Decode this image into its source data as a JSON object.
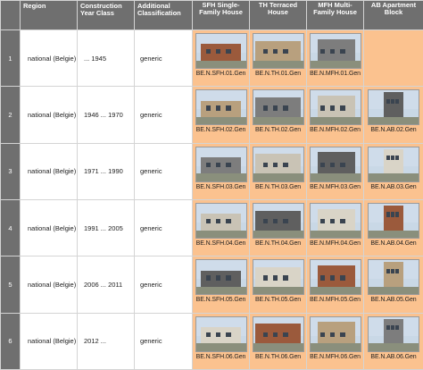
{
  "headers": {
    "rownum": "",
    "region": "Region",
    "construction": "Construction Year Class",
    "classification": "Additional Classification",
    "sfh": "SFH Single-Family House",
    "th": "TH Terraced House",
    "mfh": "MFH Multi-Family House",
    "ab": "AB Apartment Block"
  },
  "rows": [
    {
      "num": "1",
      "region": "national (Belgie)",
      "years": "... 1945",
      "cls": "generic",
      "sfh": "BE.N.SFH.01.Gen",
      "th": "BE.N.TH.01.Gen",
      "mfh": "BE.N.MFH.01.Gen",
      "ab": ""
    },
    {
      "num": "2",
      "region": "national (Belgie)",
      "years": "1946 ... 1970",
      "cls": "generic",
      "sfh": "BE.N.SFH.02.Gen",
      "th": "BE.N.TH.02.Gen",
      "mfh": "BE.N.MFH.02.Gen",
      "ab": "BE.N.AB.02.Gen"
    },
    {
      "num": "3",
      "region": "national (Belgie)",
      "years": "1971 ... 1990",
      "cls": "generic",
      "sfh": "BE.N.SFH.03.Gen",
      "th": "BE.N.TH.03.Gen",
      "mfh": "BE.N.MFH.03.Gen",
      "ab": "BE.N.AB.03.Gen"
    },
    {
      "num": "4",
      "region": "national (Belgie)",
      "years": "1991 ... 2005",
      "cls": "generic",
      "sfh": "BE.N.SFH.04.Gen",
      "th": "BE.N.TH.04.Gen",
      "mfh": "BE.N.MFH.04.Gen",
      "ab": "BE.N.AB.04.Gen"
    },
    {
      "num": "5",
      "region": "national (Belgie)",
      "years": "2006 ... 2011",
      "cls": "generic",
      "sfh": "BE.N.SFH.05.Gen",
      "th": "BE.N.TH.05.Gen",
      "mfh": "BE.N.MFH.05.Gen",
      "ab": "BE.N.AB.05.Gen"
    },
    {
      "num": "6",
      "region": "national (Belgie)",
      "years": "2012 ...",
      "cls": "generic",
      "sfh": "BE.N.SFH.06.Gen",
      "th": "BE.N.TH.06.Gen",
      "mfh": "BE.N.MFH.06.Gen",
      "ab": "BE.N.AB.06.Gen"
    }
  ],
  "colors": {
    "header_bg": "#6f6f6f",
    "image_cell_bg": "#fbc28f",
    "text_cell_bg": "#ffffff"
  }
}
